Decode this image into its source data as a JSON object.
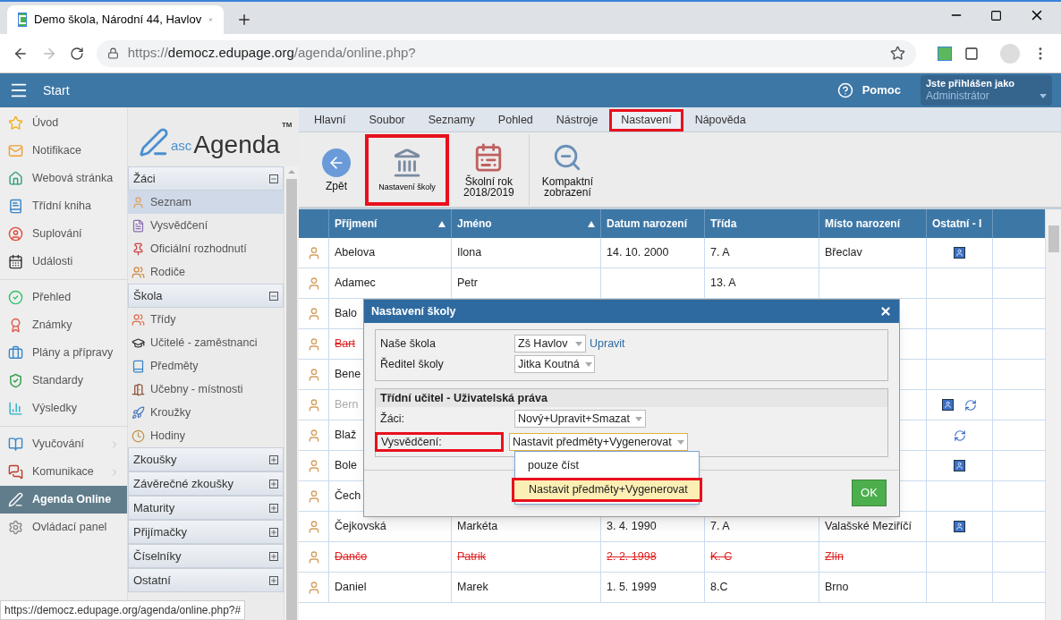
{
  "browser": {
    "tab_title": "Demo škola, Národní 44, Havlov",
    "url_scheme": "https://",
    "url_host": "democz.edupage.org",
    "url_path": "/agenda/online.php?",
    "status_url": "https://democz.edupage.org/agenda/online.php?#"
  },
  "header": {
    "start": "Start",
    "help": "Pomoc",
    "login_label": "Jste přihlášen jako",
    "login_user": "Administrátor"
  },
  "nav": [
    [
      {
        "label": "Úvod",
        "selected": false
      },
      {
        "label": "Notifikace",
        "selected": false
      },
      {
        "label": "Webová stránka",
        "selected": false
      },
      {
        "label": "Třídní kniha",
        "selected": false
      },
      {
        "label": "Suplování",
        "selected": false
      },
      {
        "label": "Události",
        "selected": false
      }
    ],
    [
      {
        "label": "Přehled",
        "selected": false
      },
      {
        "label": "Známky",
        "selected": false
      },
      {
        "label": "Plány a přípravy",
        "selected": false
      },
      {
        "label": "Standardy",
        "selected": false
      },
      {
        "label": "Výsledky",
        "selected": false
      }
    ],
    [
      {
        "label": "Vyučování",
        "selected": false,
        "submenu": true
      },
      {
        "label": "Komunikace",
        "selected": false,
        "submenu": true
      },
      {
        "label": "Agenda Online",
        "selected": true,
        "submenu": false
      },
      {
        "label": "Ovládací panel",
        "selected": false,
        "submenu": false
      }
    ]
  ],
  "logo": {
    "prefix": "asc",
    "name": "Agenda",
    "tm": "TM"
  },
  "sections": [
    {
      "title": "Žáci",
      "expanded": true,
      "items": [
        {
          "label": "Seznam",
          "selected": true
        },
        {
          "label": "Vysvědčení",
          "selected": false
        },
        {
          "label": "Oficiální rozhodnutí",
          "selected": false
        },
        {
          "label": "Rodiče",
          "selected": false
        }
      ]
    },
    {
      "title": "Škola",
      "expanded": true,
      "items": [
        {
          "label": "Třídy",
          "selected": false
        },
        {
          "label": "Učitelé - zaměstnanci",
          "selected": false
        },
        {
          "label": "Předměty",
          "selected": false
        },
        {
          "label": "Učebny - místnosti",
          "selected": false
        },
        {
          "label": "Kroužky",
          "selected": false
        },
        {
          "label": "Hodiny",
          "selected": false
        }
      ]
    },
    {
      "title": "Zkoušky",
      "expanded": false
    },
    {
      "title": "Závěrečné zkoušky",
      "expanded": false
    },
    {
      "title": "Maturity",
      "expanded": false
    },
    {
      "title": "Přijímačky",
      "expanded": false
    },
    {
      "title": "Číselníky",
      "expanded": false
    },
    {
      "title": "Ostatní",
      "expanded": false
    }
  ],
  "menu_tabs": [
    {
      "label": "Hlavní",
      "selected": false,
      "highlighted": false
    },
    {
      "label": "Soubor",
      "selected": false,
      "highlighted": false
    },
    {
      "label": "Seznamy",
      "selected": false,
      "highlighted": false
    },
    {
      "label": "Pohled",
      "selected": false,
      "highlighted": false
    },
    {
      "label": "Nástroje",
      "selected": false,
      "highlighted": false
    },
    {
      "label": "Nastavení",
      "selected": true,
      "highlighted": true
    },
    {
      "label": "Nápověda",
      "selected": false,
      "highlighted": false
    }
  ],
  "toolbar": [
    {
      "kind": "back",
      "label": "Zpět",
      "highlighted": false
    },
    {
      "kind": "school",
      "label": "Nastavení školy",
      "highlighted": true
    },
    {
      "kind": "year",
      "label": "Školní rok",
      "sub": "2018/2019",
      "highlighted": false
    },
    {
      "kind": "compact",
      "label": "Kompaktní",
      "sub": "zobrazení",
      "highlighted": false
    }
  ],
  "table": {
    "columns": [
      {
        "label": "Příjmení",
        "sorted": true
      },
      {
        "label": "Jméno",
        "sorted": true
      },
      {
        "label": "Datum narození",
        "sorted": false
      },
      {
        "label": "Třída",
        "sorted": false
      },
      {
        "label": "Místo narození",
        "sorted": false
      },
      {
        "label": "Ostatní - I",
        "sorted": false
      }
    ],
    "rows": [
      {
        "deleted": false,
        "inactive": false,
        "cells": [
          "Abelova",
          "Ilona",
          "14. 10. 2000",
          "7. A",
          "Břeclav"
        ],
        "card": true,
        "sync": false
      },
      {
        "deleted": false,
        "inactive": false,
        "cells": [
          "Adamec",
          "Petr",
          "",
          "13. A",
          ""
        ],
        "card": false,
        "sync": false
      },
      {
        "deleted": false,
        "inactive": false,
        "cells": [
          "Balo"
        ],
        "card": false,
        "sync": false
      },
      {
        "deleted": true,
        "inactive": false,
        "cells": [
          "Bart"
        ],
        "card": false,
        "sync": false
      },
      {
        "deleted": false,
        "inactive": false,
        "cells": [
          "Bene"
        ],
        "card": false,
        "sync": false
      },
      {
        "deleted": false,
        "inactive": true,
        "cells": [
          "Bern"
        ],
        "card": true,
        "sync": true
      },
      {
        "deleted": false,
        "inactive": false,
        "cells": [
          "Blaž"
        ],
        "card": false,
        "sync": true
      },
      {
        "deleted": false,
        "inactive": false,
        "cells": [
          "Bole"
        ],
        "card": true,
        "sync": false
      },
      {
        "deleted": false,
        "inactive": false,
        "cells": [
          "Čech"
        ],
        "card": false,
        "sync": false
      },
      {
        "deleted": false,
        "inactive": false,
        "cells": [
          "Čejkovská",
          "Markéta",
          "3. 4. 1990",
          "7. A",
          "Valašské Meziříčí"
        ],
        "card": true,
        "sync": false
      },
      {
        "deleted": true,
        "inactive": false,
        "cells": [
          "Dančo",
          "Patrik",
          "2. 2. 1998",
          "K. C",
          "Zlín"
        ],
        "card": false,
        "sync": false
      },
      {
        "deleted": false,
        "inactive": false,
        "cells": [
          "Daniel",
          "Marek",
          "1. 5. 1999",
          "8.C",
          "Brno"
        ],
        "card": false,
        "sync": false
      }
    ]
  },
  "dialog": {
    "title": "Nastavení školy",
    "school_label": "Naše škola",
    "school_value": "Zš Havlov",
    "edit_link": "Upravit",
    "director_label": "Ředitel školy",
    "director_value": "Jitka Koutná",
    "group_title": "Třídní učitel - Uživatelská práva",
    "rights": [
      {
        "label": "Žáci:",
        "value": "Nový+Upravit+Smazat",
        "highlighted": false,
        "open": false
      },
      {
        "label": "Vysvědčení:",
        "value": "Nastavit předměty+Vygenerovat",
        "highlighted": true,
        "open": true
      }
    ],
    "options": [
      {
        "label": "pouze číst",
        "selected": false,
        "highlighted": false
      },
      {
        "label": "Nastavit předměty+Vygenerovat",
        "selected": true,
        "highlighted": true
      }
    ],
    "ok": "OK"
  }
}
